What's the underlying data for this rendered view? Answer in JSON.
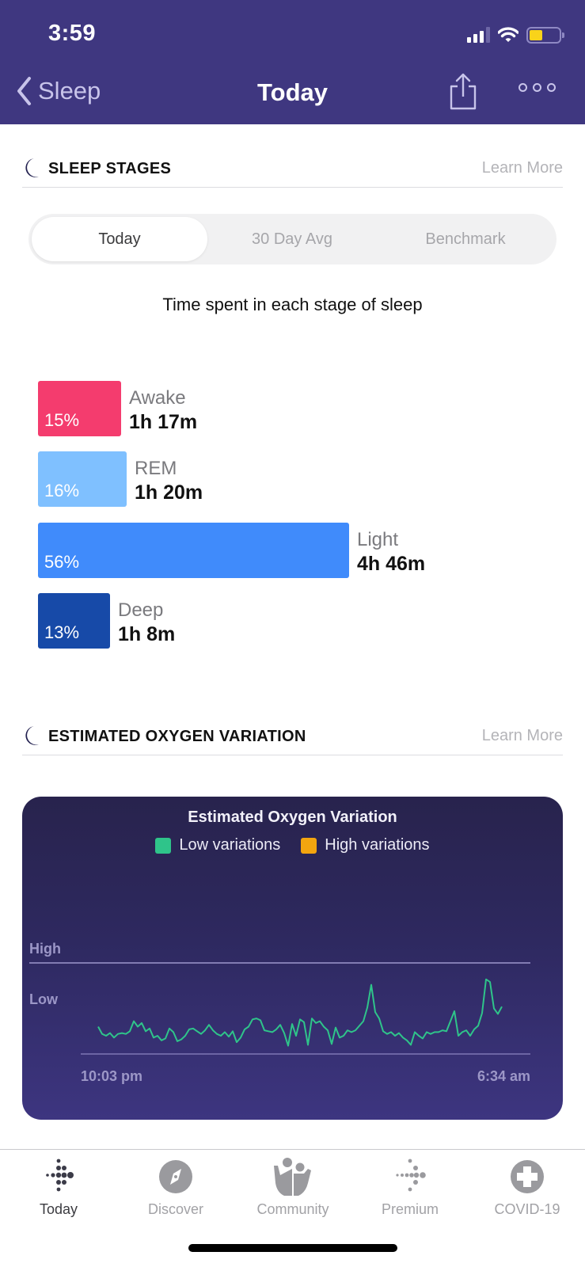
{
  "status_bar": {
    "time": "3:59",
    "icons": [
      "cellular-signal-icon",
      "wifi-icon",
      "battery-low-icon"
    ],
    "battery_color": "#f9d31a"
  },
  "nav": {
    "back_label": "Sleep",
    "title": "Today",
    "share_icon": "share-icon",
    "more_icon": "more-options-icon"
  },
  "colors": {
    "header_bg": "#3f3780",
    "awake": "#f43c6e",
    "rem": "#7fc0ff",
    "light": "#408bfb",
    "deep": "#174aa8",
    "low_variation": "#2fc48a",
    "high_variation": "#f3a50f"
  },
  "sleep_stages": {
    "section_title": "SLEEP STAGES",
    "learn_more": "Learn More",
    "tabs": [
      {
        "label": "Today",
        "active": true
      },
      {
        "label": "30 Day Avg",
        "active": false
      },
      {
        "label": "Benchmark",
        "active": false
      }
    ],
    "subtitle": "Time spent in each stage of sleep",
    "stages": [
      {
        "name": "Awake",
        "percent_label": "15%",
        "percent": 15,
        "duration": "1h 17m"
      },
      {
        "name": "REM",
        "percent_label": "16%",
        "percent": 16,
        "duration": "1h 20m"
      },
      {
        "name": "Light",
        "percent_label": "56%",
        "percent": 56,
        "duration": "4h 46m"
      },
      {
        "name": "Deep",
        "percent_label": "13%",
        "percent": 13,
        "duration": "1h 8m"
      }
    ]
  },
  "oxygen": {
    "section_title": "ESTIMATED OXYGEN VARIATION",
    "learn_more": "Learn More"
  },
  "chart_data": {
    "type": "line",
    "title": "Estimated Oxygen Variation",
    "legend": [
      {
        "label": "Low variations",
        "color": "#2fc48a"
      },
      {
        "label": "High variations",
        "color": "#f3a50f"
      }
    ],
    "legend_position": "top-center",
    "y_tick_labels": [
      "High",
      "Low"
    ],
    "x_tick_labels": [
      "10:03 pm",
      "6:34 am"
    ],
    "ylim": [
      0,
      1
    ],
    "high_threshold": 1.0,
    "series": [
      {
        "name": "Low variations",
        "color": "#2fc48a",
        "values": [
          0.3,
          0.22,
          0.2,
          0.23,
          0.18,
          0.22,
          0.23,
          0.22,
          0.25,
          0.36,
          0.3,
          0.34,
          0.25,
          0.28,
          0.18,
          0.2,
          0.15,
          0.17,
          0.28,
          0.24,
          0.14,
          0.16,
          0.2,
          0.27,
          0.28,
          0.25,
          0.22,
          0.26,
          0.32,
          0.26,
          0.22,
          0.2,
          0.24,
          0.19,
          0.25,
          0.13,
          0.18,
          0.27,
          0.3,
          0.38,
          0.39,
          0.37,
          0.26,
          0.25,
          0.24,
          0.27,
          0.32,
          0.23,
          0.09,
          0.33,
          0.2,
          0.38,
          0.35,
          0.1,
          0.39,
          0.34,
          0.36,
          0.3,
          0.26,
          0.11,
          0.29,
          0.18,
          0.2,
          0.26,
          0.24,
          0.26,
          0.31,
          0.36,
          0.51,
          0.76,
          0.46,
          0.39,
          0.25,
          0.22,
          0.24,
          0.2,
          0.23,
          0.18,
          0.15,
          0.1,
          0.24,
          0.2,
          0.17,
          0.24,
          0.22,
          0.24,
          0.24,
          0.26,
          0.25,
          0.36,
          0.47,
          0.2,
          0.24,
          0.26,
          0.2,
          0.27,
          0.31,
          0.45,
          0.82,
          0.79,
          0.5,
          0.44,
          0.52
        ]
      }
    ],
    "xlabel": "",
    "ylabel": ""
  },
  "tabbar": {
    "items": [
      {
        "label": "Today",
        "icon": "fitbit-logo-icon",
        "active": true
      },
      {
        "label": "Discover",
        "icon": "compass-icon",
        "active": false
      },
      {
        "label": "Community",
        "icon": "community-icon",
        "active": false
      },
      {
        "label": "Premium",
        "icon": "premium-icon",
        "active": false
      },
      {
        "label": "COVID-19",
        "icon": "medical-cross-icon",
        "active": false
      }
    ]
  }
}
